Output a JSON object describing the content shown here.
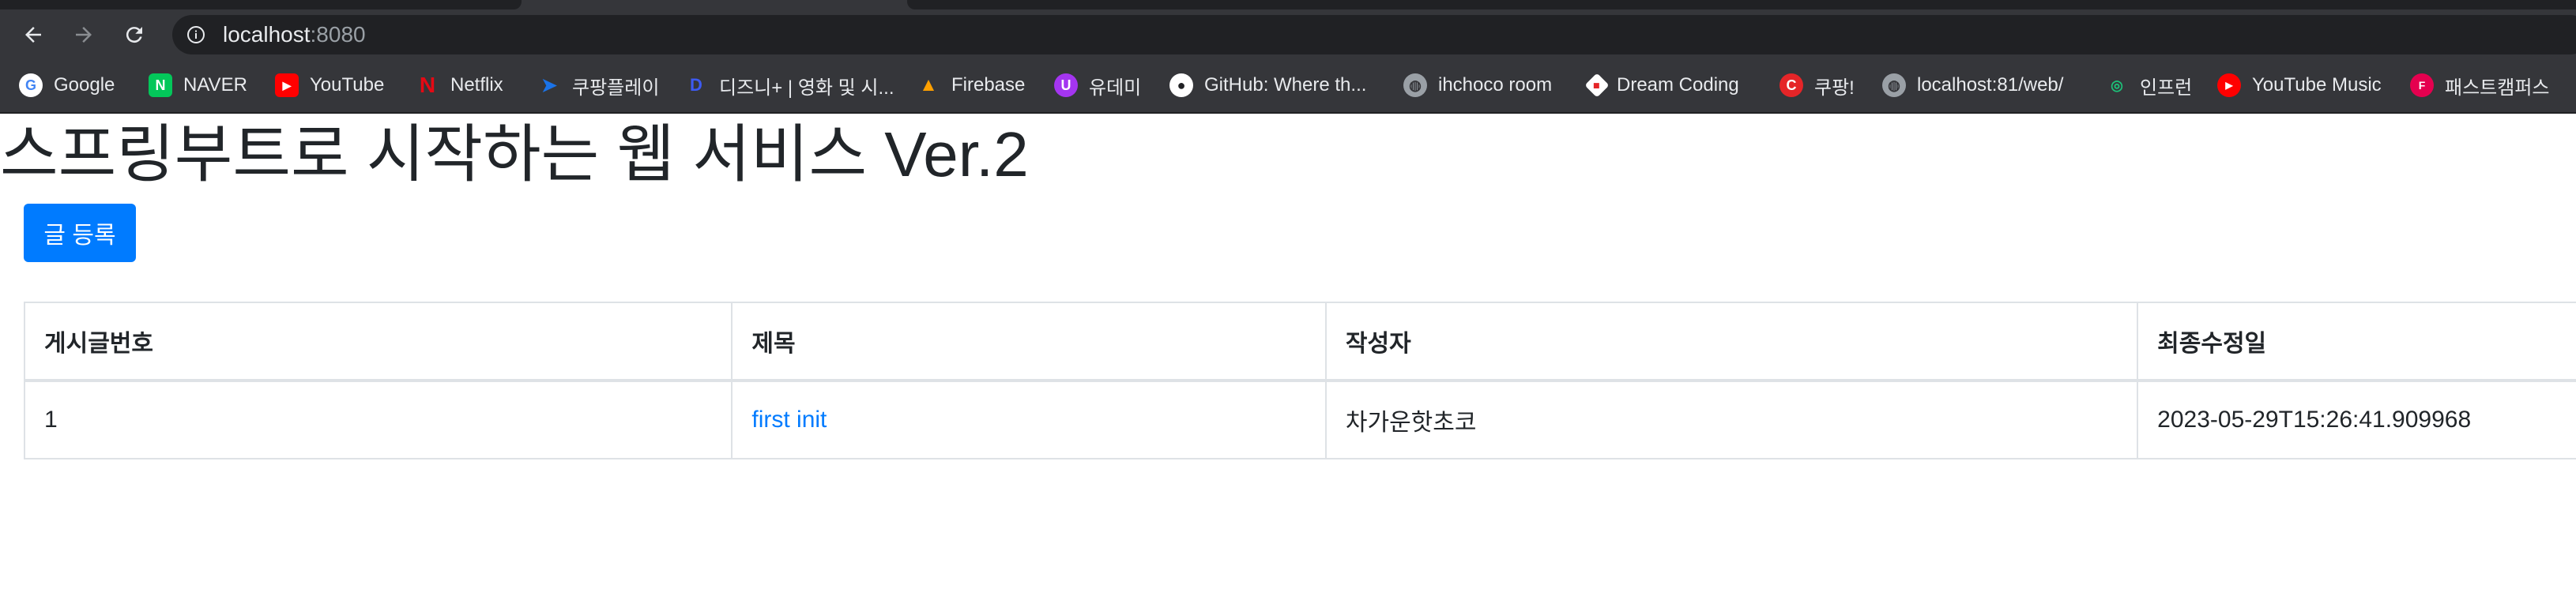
{
  "browser": {
    "url_host": "localhost",
    "url_port": ":8080",
    "bookmarks": [
      {
        "label": "Google",
        "icon": "google-icon",
        "color": "#ffffff"
      },
      {
        "label": "NAVER",
        "icon": "naver-icon",
        "color": "#03c75a"
      },
      {
        "label": "YouTube",
        "icon": "youtube-icon",
        "color": "#ff0000"
      },
      {
        "label": "Netflix",
        "icon": "netflix-icon",
        "color": "#e50914"
      },
      {
        "label": "쿠팡플레이",
        "icon": "coupang-play-icon",
        "color": "#1a73e8"
      },
      {
        "label": "디즈니+ | 영화 및 시...",
        "icon": "disney-plus-icon",
        "color": "#1c2bd6"
      },
      {
        "label": "Firebase",
        "icon": "firebase-icon",
        "color": "#ffa000"
      },
      {
        "label": "유데미",
        "icon": "udemy-icon",
        "color": "#a435f0"
      },
      {
        "label": "GitHub: Where th...",
        "icon": "github-icon",
        "color": "#ffffff"
      },
      {
        "label": "ihchoco room",
        "icon": "globe-icon",
        "color": "#9aa0a6"
      },
      {
        "label": "Dream Coding",
        "icon": "dream-coding-icon",
        "color": "#ffffff"
      },
      {
        "label": "쿠팡!",
        "icon": "coupang-icon",
        "color": "#e52528"
      },
      {
        "label": "localhost:81/web/",
        "icon": "globe-icon",
        "color": "#9aa0a6"
      },
      {
        "label": "인프런",
        "icon": "inflearn-icon",
        "color": "#1dc078"
      },
      {
        "label": "YouTube Music",
        "icon": "youtube-music-icon",
        "color": "#ff0000"
      },
      {
        "label": "패스트캠퍼스",
        "icon": "fastcampus-icon",
        "color": "#e5004f"
      }
    ]
  },
  "page": {
    "title": "스프링부트로 시작하는 웹 서비스 Ver.2",
    "register_button": "글 등록",
    "accent_color": "#007bff"
  },
  "table": {
    "headers": [
      "게시글번호",
      "제목",
      "작성자",
      "최종수정일"
    ],
    "rows": [
      {
        "id": "1",
        "title": "first init",
        "author": "차가운핫초코",
        "modified": "2023-05-29T15:26:41.909968"
      }
    ]
  }
}
